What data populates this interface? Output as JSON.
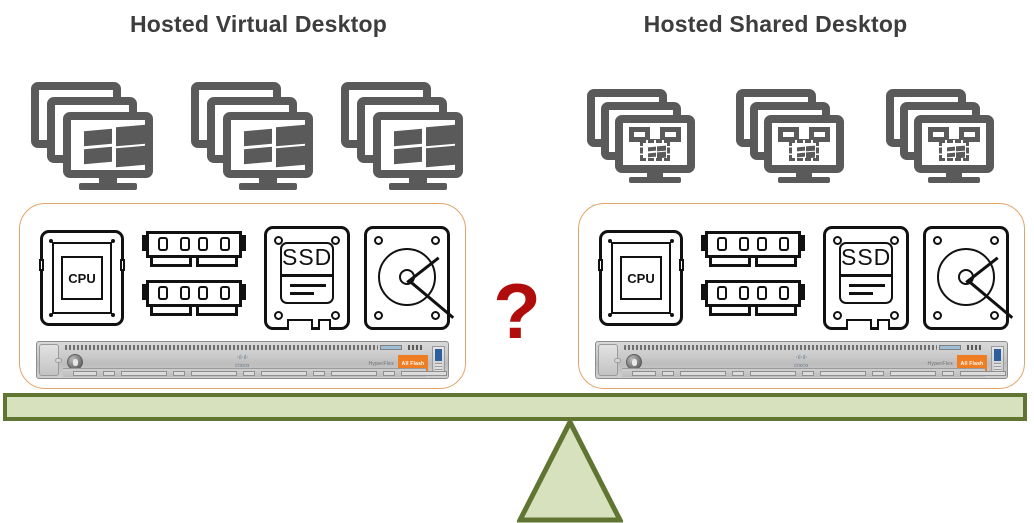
{
  "titles": {
    "left": "Hosted Virtual Desktop",
    "right": "Hosted Shared Desktop"
  },
  "center": {
    "question_mark": "?",
    "question_color": "#b10c0c"
  },
  "balance": {
    "beam_fill": "#d7e1bd",
    "beam_stroke": "#5f7531",
    "fulcrum_fill": "#d7e1bd",
    "fulcrum_stroke": "#5f7531"
  },
  "left_side": {
    "title": "Hosted Virtual Desktop",
    "endpoint_icon": "windows-desktop-stack-icon",
    "endpoint_count": 3,
    "panel_border_color": "#e2a469",
    "hardware": [
      {
        "name": "cpu",
        "label": "CPU"
      },
      {
        "name": "ram",
        "label": "",
        "chips": 4,
        "sticks": 2
      },
      {
        "name": "ssd",
        "label": "SSD"
      },
      {
        "name": "hdd",
        "label": ""
      }
    ],
    "server": {
      "brand": "cisco",
      "brand_bars": "⋅ıl⋅ıl⋅",
      "model_text": "HyperFlex",
      "badge_text": "All Flash",
      "badge_color": "#ef7d22"
    }
  },
  "right_side": {
    "title": "Hosted Shared Desktop",
    "endpoint_icon": "shared-session-desktop-stack-icon",
    "endpoint_count": 3,
    "panel_border_color": "#e2a469",
    "hardware": [
      {
        "name": "cpu",
        "label": "CPU"
      },
      {
        "name": "ram",
        "label": "",
        "chips": 4,
        "sticks": 2
      },
      {
        "name": "ssd",
        "label": "SSD"
      },
      {
        "name": "hdd",
        "label": ""
      }
    ],
    "server": {
      "brand": "cisco",
      "brand_bars": "⋅ıl⋅ıl⋅",
      "model_text": "HyperFlex",
      "badge_text": "All Flash",
      "badge_color": "#ef7d22"
    }
  }
}
